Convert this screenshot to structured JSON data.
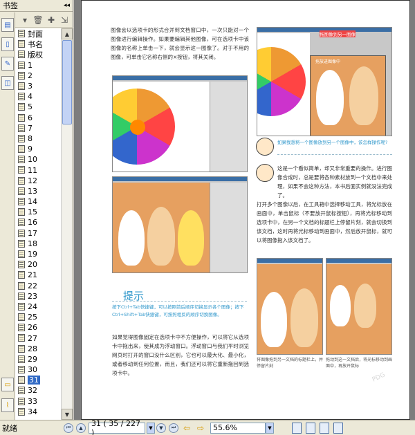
{
  "panel": {
    "title": "书签",
    "collapse_glyph": "◂◂",
    "bookmarks": [
      {
        "label": "封面"
      },
      {
        "label": "书名"
      },
      {
        "label": "版权"
      },
      {
        "label": "1"
      },
      {
        "label": "2"
      },
      {
        "label": "3"
      },
      {
        "label": "4"
      },
      {
        "label": "5"
      },
      {
        "label": "6"
      },
      {
        "label": "7"
      },
      {
        "label": "8"
      },
      {
        "label": "9"
      },
      {
        "label": "10"
      },
      {
        "label": "11"
      },
      {
        "label": "12"
      },
      {
        "label": "13"
      },
      {
        "label": "14"
      },
      {
        "label": "15"
      },
      {
        "label": "16"
      },
      {
        "label": "17"
      },
      {
        "label": "18"
      },
      {
        "label": "19"
      },
      {
        "label": "20"
      },
      {
        "label": "21"
      },
      {
        "label": "22"
      },
      {
        "label": "23"
      },
      {
        "label": "24"
      },
      {
        "label": "25"
      },
      {
        "label": "26"
      },
      {
        "label": "27"
      },
      {
        "label": "28"
      },
      {
        "label": "29"
      },
      {
        "label": "30"
      },
      {
        "label": "31",
        "selected": true
      },
      {
        "label": "32"
      },
      {
        "label": "33"
      },
      {
        "label": "34"
      }
    ]
  },
  "document": {
    "para1": "图像会以选项卡的形式合并到文档窗口中，一次只能对一个图像进行编辑操作。如果要编辑其他图像，可在选项卡中该图像的名称上单击一下，就会显示这一图像了。对于不用的图像，可单击它名称右侧的×按钮，将其关闭。",
    "tip_title": "提示",
    "tip_text": "按下Ctrl+Tab快捷键，可以按照前后顺序切换显示各个图像；按下Ctrl+Shift+Tab快捷键，可按照相反的顺序切换图像。",
    "para2": "如果觉得图像固定在选项卡中不方便操作，可以将它从选项卡中拖出来，使其成为浮动窗口。浮动窗口与我们平时浏览网页时打开的窗口没什么区别，它也可以最大化、最小化，或者移动到任何位置，而且，我们还可以将它重新拖回到选项卡中。",
    "right_label_top": "拖图像到另一图像",
    "right_label_inner": "拖放进图像中",
    "question": "如果我想将一个图像放到另一个图像中，该怎样操作呢?",
    "answer_lead": "这是一个看似简单，却又非常重要的操作。进行图像合成时，总是要将各种素材放到一个文档中来处理，如果不会这种方法，本书后面实例就没法完成了。",
    "answer_body": "打开多个图像以后，在工具箱中选择移动工具，将光标放在画面中，单击鼠标（不要放开鼠标按钮），再将光标移动到选项卡中，在另一个文档的标题栏上停留片刻，就会切换到该文档，这时再将光标移动到画面中，然后放开鼠标，就可以将图像拖入该文档了。",
    "caption_left": "将图像拖到另一文档的标题栏上，并停留片刻",
    "caption_right": "拖动到这一文档后，将光标移动到画面中，再放开鼠标",
    "watermark": "PDG"
  },
  "statusbar": {
    "status": "就绪",
    "page_current": "31",
    "page_total": "35 / 227",
    "page_display": "31  ( 35 / 227 )",
    "zoom": "55.6%"
  },
  "colors": {
    "accent": "#316ac5",
    "tip": "#3399cc"
  }
}
